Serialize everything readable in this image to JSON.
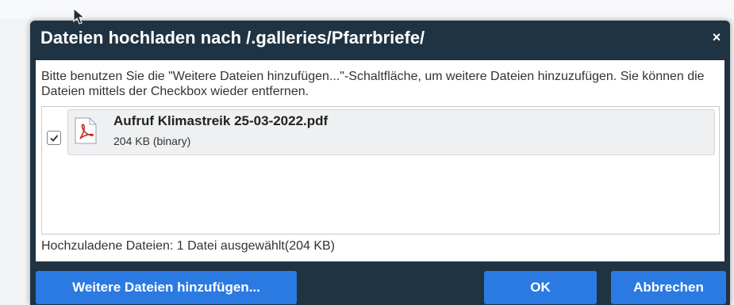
{
  "dialog": {
    "title": "Dateien hochladen nach /.galleries/Pfarrbriefe/",
    "close_glyph": "×",
    "instructions": "Bitte benutzen Sie die \"Weitere Dateien hinzufügen...\"-Schaltfläche, um weitere Dateien hinzuzufügen. Sie können die Dateien mittels der Checkbox wieder entfernen.",
    "files": [
      {
        "name": "Aufruf Klimastreik 25-03-2022.pdf",
        "meta": "204 KB (binary)",
        "icon": "pdf-icon",
        "checked": true
      }
    ],
    "summary": "Hochzuladene Dateien: 1 Datei ausgewählt(204 KB)",
    "buttons": {
      "add": "Weitere Dateien hinzufügen...",
      "ok": "OK",
      "cancel": "Abbrechen"
    }
  },
  "colors": {
    "dialog_bg": "#203342",
    "button_bg": "#2a7ae2",
    "pdf_red": "#c8281e"
  }
}
